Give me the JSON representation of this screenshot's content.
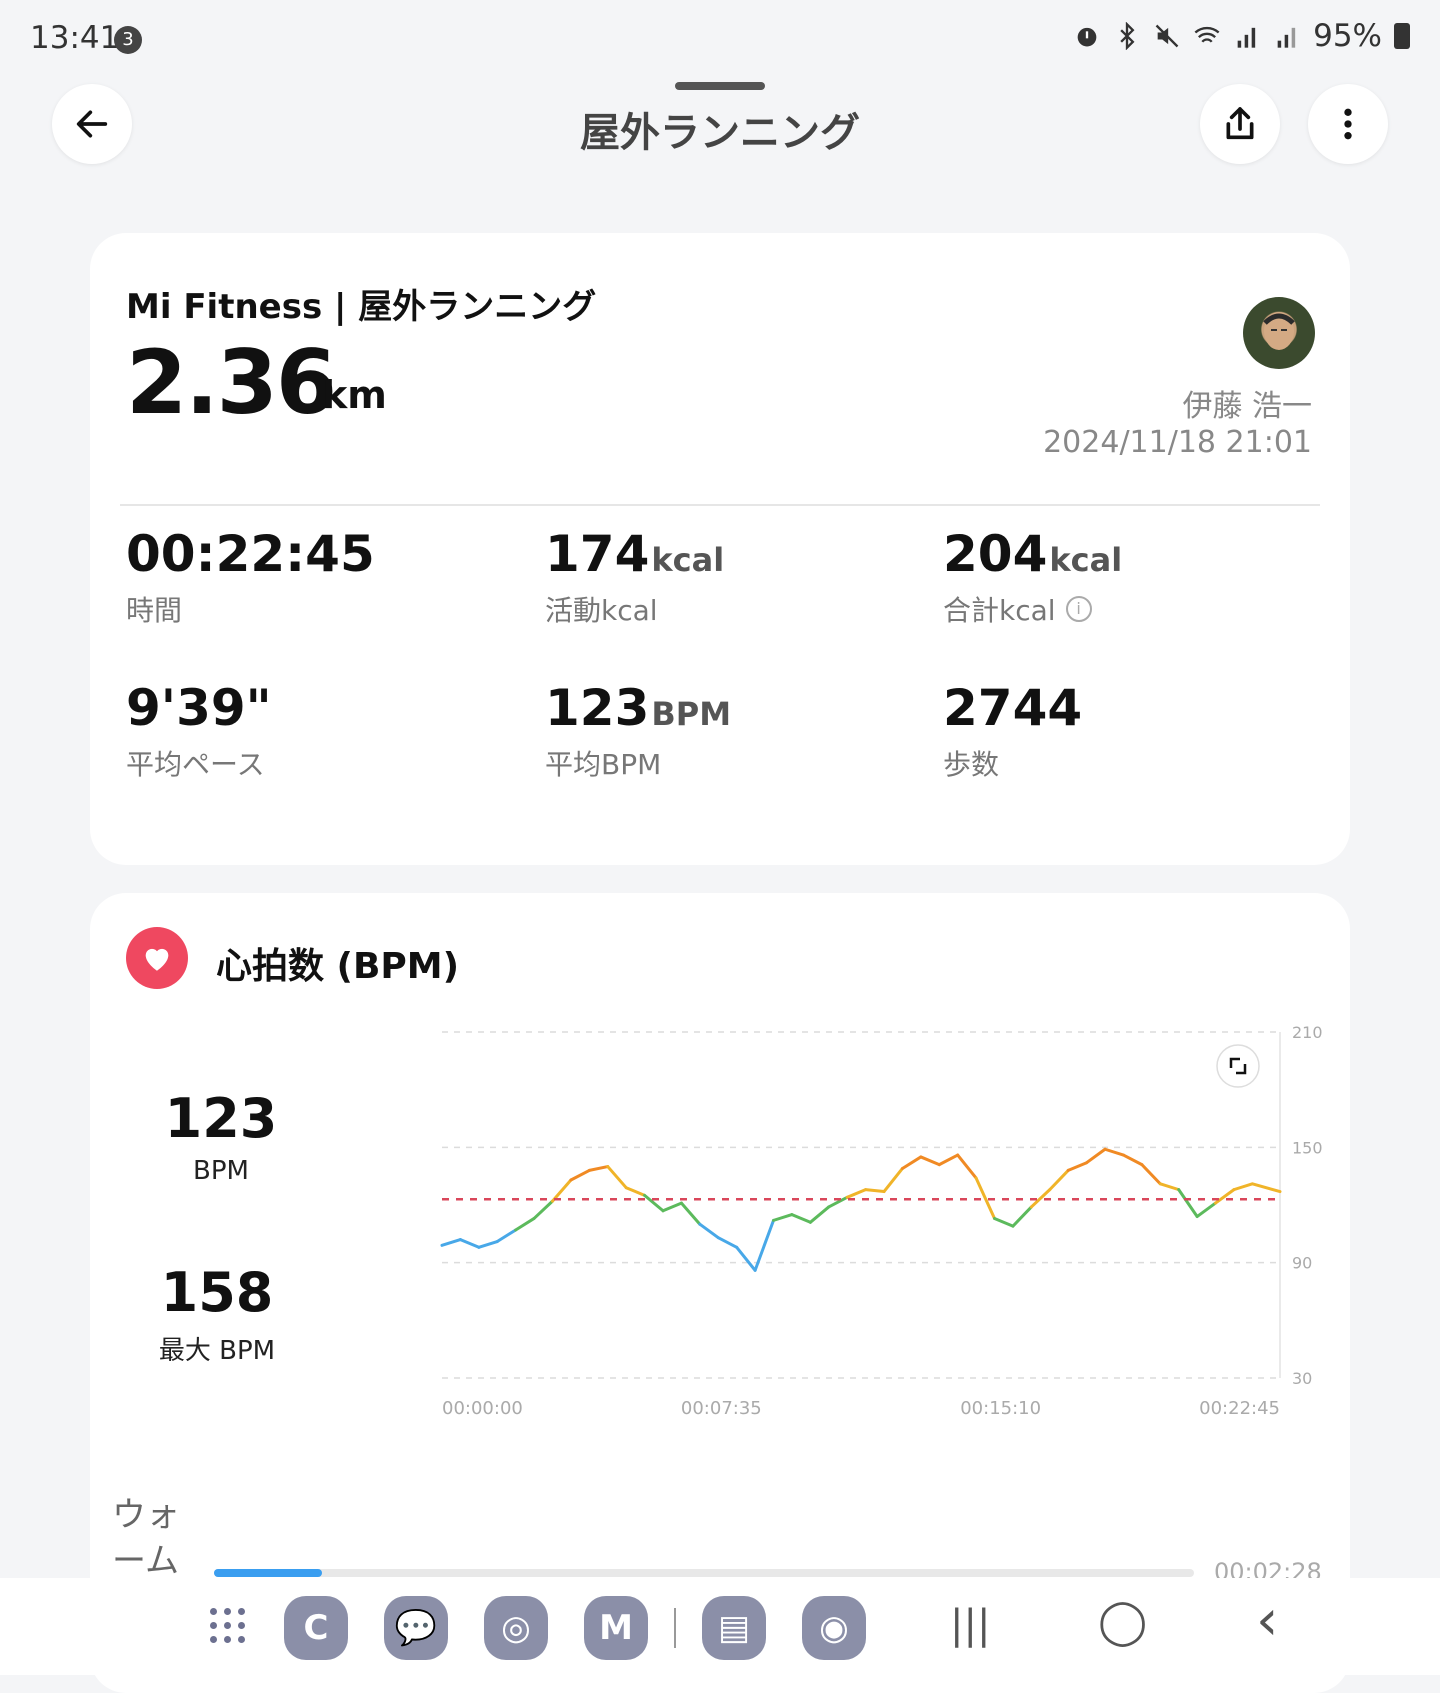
{
  "status_bar": {
    "time": "13:41",
    "notification_count": "3",
    "battery": "95%"
  },
  "header": {
    "title": "屋外ランニング"
  },
  "summary": {
    "app_title": "Mi Fitness | 屋外ランニング",
    "distance": "2.36",
    "distance_unit": "km",
    "user_name": "伊藤 浩一",
    "datetime": "2024/11/18 21:01",
    "stats": [
      {
        "value": "00:22:45",
        "unit": "",
        "label": "時間"
      },
      {
        "value": "174",
        "unit": "kcal",
        "label": "活動kcal"
      },
      {
        "value": "204",
        "unit": "kcal",
        "label": "合計kcal"
      },
      {
        "value": "9'39\"",
        "unit": "",
        "label": "平均ペース"
      },
      {
        "value": "123",
        "unit": "BPM",
        "label": "平均BPM"
      },
      {
        "value": "2744",
        "unit": "",
        "label": "歩数"
      }
    ]
  },
  "heart_rate": {
    "title": "心拍数 (BPM)",
    "avg_value": "123",
    "avg_label": "BPM",
    "max_value": "158",
    "max_label": "最大 BPM"
  },
  "chart_data": {
    "type": "line",
    "title": "",
    "xlabel": "",
    "ylabel": "",
    "ylim": [
      30,
      210
    ],
    "y_ticks": [
      "210",
      "150",
      "90",
      "30"
    ],
    "x_ticks": [
      "00:00:00",
      "00:07:35",
      "00:15:10",
      "00:22:45"
    ],
    "reference_line": 123,
    "grid": "horizontal dashed",
    "series": [
      {
        "name": "",
        "x_minutes": [
          0,
          0.5,
          1,
          1.5,
          2,
          2.5,
          3,
          3.5,
          4,
          4.5,
          5,
          5.5,
          6,
          6.5,
          7,
          7.5,
          8,
          8.5,
          9,
          9.5,
          10,
          10.5,
          11,
          11.5,
          12,
          12.5,
          13,
          13.5,
          14,
          14.5,
          15,
          15.5,
          16,
          16.5,
          17,
          17.5,
          18,
          18.5,
          19,
          19.5,
          20,
          20.5,
          21,
          21.5,
          22,
          22.75
        ],
        "values": [
          99,
          102,
          98,
          101,
          107,
          113,
          122,
          133,
          138,
          140,
          129,
          125,
          117,
          121,
          110,
          103,
          98,
          86,
          112,
          115,
          111,
          119,
          124,
          128,
          127,
          139,
          145,
          141,
          146,
          134,
          113,
          109,
          119,
          128,
          138,
          142,
          149,
          146,
          141,
          131,
          128,
          114,
          121,
          128,
          131,
          127
        ],
        "colors_by_zone": {
          "easy": "#48a8e8",
          "fat_burn": "#5cba5c",
          "aerobic": "#f0b429",
          "anaerobic": "#f08a24",
          "max": "#e5535c"
        }
      }
    ]
  },
  "zones": {
    "label": "ウォーム",
    "time": "00:02:28",
    "fraction": 0.11
  },
  "nav": {
    "apps": [
      {
        "name": "phone",
        "glyph": "C"
      },
      {
        "name": "messages",
        "glyph": "💬"
      },
      {
        "name": "chrome",
        "glyph": "◎"
      },
      {
        "name": "gmail",
        "glyph": "M"
      },
      {
        "name": "reader",
        "glyph": "▤"
      },
      {
        "name": "instagram",
        "glyph": "◉"
      }
    ],
    "recents": "|||",
    "home": "◯",
    "back": "‹"
  }
}
